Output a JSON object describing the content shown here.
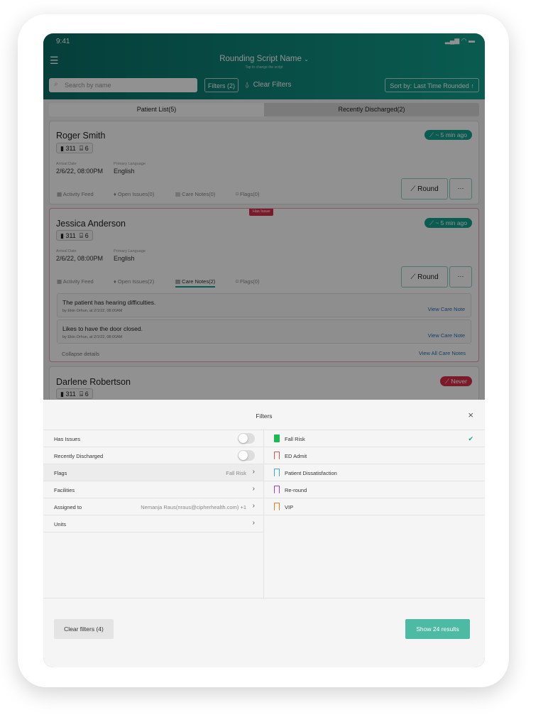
{
  "status": {
    "time": "9:41"
  },
  "header": {
    "title": "Rounding Script Name",
    "subtitle": "Tap to change the script",
    "search_placeholder": "Search by name",
    "filters_btn": "Filters (2)",
    "clear_filters": "Clear Filters",
    "sort": "Sort by: Last Time Rounded"
  },
  "tabs": [
    {
      "label": "Patient List(5)"
    },
    {
      "label": "Recently Discharged(2)"
    }
  ],
  "patients": [
    {
      "name": "Roger Smith",
      "room": "311",
      "bed": "6",
      "last_rounded": "~ 5 min ago",
      "arrival_label": "Arrival Date",
      "arrival": "2/6/22, 08:00PM",
      "lang_label": "Primary Language",
      "lang": "English",
      "links": [
        "Activity Feed",
        "Open Issues(0)",
        "Care Notes(0)",
        "Flags(0)"
      ],
      "round": "Round",
      "more": "···"
    },
    {
      "name": "Jessica Anderson",
      "badge": "Has Issue",
      "room": "311",
      "bed": "6",
      "last_rounded": "~ 5 min ago",
      "arrival_label": "Arrival Date",
      "arrival": "2/6/22, 08:00PM",
      "lang_label": "Primary Language",
      "lang": "English",
      "links": [
        "Activity Feed",
        "Open Issues(2)",
        "Care Notes(2)",
        "Flags(0)"
      ],
      "round": "Round",
      "more": "···",
      "notes": [
        {
          "text": "The patient has hearing difficulties.",
          "by": "by Ekin Orhun, at 2/1/22, 08:00AM",
          "link": "View Care Note"
        },
        {
          "text": "Likes to have the door closed.",
          "by": "by Ekin Orhun, at 2/1/22, 08:00AM",
          "link": "View Care Note"
        }
      ],
      "collapse": "Collapse details",
      "view_all": "View All Care Notes"
    },
    {
      "name": "Darlene Robertson",
      "room": "311",
      "bed": "6",
      "last_rounded": "Never"
    }
  ],
  "filters": {
    "title": "Filters",
    "close": "×",
    "left": [
      {
        "label": "Has Issues"
      },
      {
        "label": "Recently Discharged"
      },
      {
        "label": "Flags",
        "value": "Fall Risk"
      },
      {
        "label": "Facilities"
      },
      {
        "label": "Assigned to",
        "value": "Nemanja Raus(nraus@cipherhealth.com) +1"
      },
      {
        "label": "Units"
      }
    ],
    "flags": [
      {
        "label": "Fall Risk",
        "color": "#1db954",
        "checked": true
      },
      {
        "label": "ED Admit",
        "color": "#d9534f"
      },
      {
        "label": "Patient Dissatisfaction",
        "color": "#3aa7c9"
      },
      {
        "label": "Re-round",
        "color": "#a23ad6"
      },
      {
        "label": "VIP",
        "color": "#f07a22"
      }
    ],
    "check": "✔",
    "clear": "Clear filters (4)",
    "show": "Show 24 results"
  },
  "colors": {
    "accent": "#12a08d",
    "danger": "#d8314b",
    "primary_button": "#4dbaa3"
  }
}
